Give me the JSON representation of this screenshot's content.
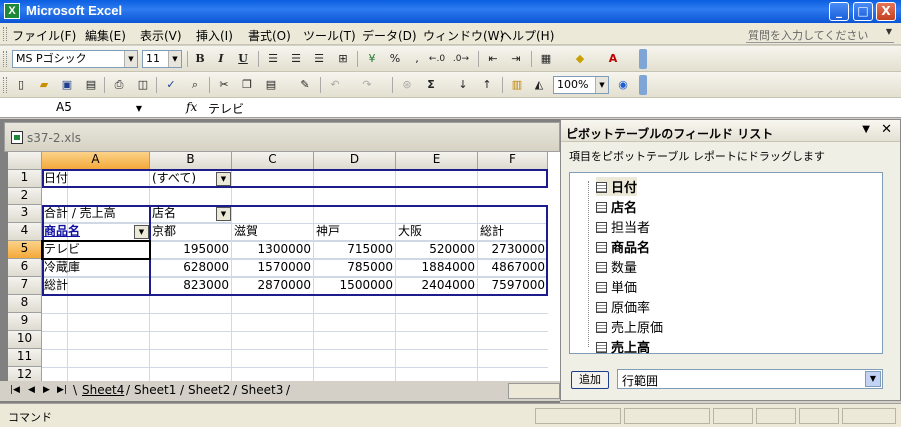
{
  "window": {
    "title": "Microsoft Excel",
    "min": "_",
    "max": "□",
    "close": "X"
  },
  "menu": {
    "items": [
      "ファイル(F)",
      "編集(E)",
      "表示(V)",
      "挿入(I)",
      "書式(O)",
      "ツール(T)",
      "データ(D)",
      "ウィンドウ(W)",
      "ヘルプ(H)"
    ],
    "help_placeholder": "質問を入力してください"
  },
  "toolbar_format": {
    "font": "MS Pゴシック",
    "size": "11",
    "bold": "B",
    "italic": "I",
    "underline": "U",
    "percent": "%",
    "comma": ","
  },
  "toolbar_standard": {
    "sigma": "Σ",
    "zoom": "100%"
  },
  "formula_bar": {
    "name_box": "A5",
    "fx": "fx",
    "value": "テレビ"
  },
  "workbook": {
    "title": "s37-2.xls",
    "columns": [
      "A",
      "B",
      "C",
      "D",
      "E",
      "F"
    ],
    "rows": [
      "1",
      "2",
      "3",
      "4",
      "5",
      "6",
      "7",
      "8",
      "9",
      "10",
      "11",
      "12"
    ],
    "cells": {
      "r1": {
        "a": "日付",
        "b": "(すべて)"
      },
      "r3": {
        "a": "合計 / 売上高",
        "b": "店名"
      },
      "r4": {
        "a": "商品名",
        "b": "京都",
        "c": "滋賀",
        "d": "神戸",
        "e": "大阪",
        "f": "総計"
      },
      "r5": {
        "a": "テレビ",
        "b": "195000",
        "c": "1300000",
        "d": "715000",
        "e": "520000",
        "f": "2730000"
      },
      "r6": {
        "a": "冷蔵庫",
        "b": "628000",
        "c": "1570000",
        "d": "785000",
        "e": "1884000",
        "f": "4867000"
      },
      "r7": {
        "a": "総計",
        "b": "823000",
        "c": "2870000",
        "d": "1500000",
        "e": "2404000",
        "f": "7597000"
      }
    },
    "sheets": [
      "Sheet4",
      "Sheet1",
      "Sheet2",
      "Sheet3"
    ],
    "active_sheet": "Sheet4"
  },
  "pivot_pane": {
    "title": "ピボットテーブルのフィールド リスト",
    "instruction": "項目をピボットテーブル レポートにドラッグします",
    "fields": [
      {
        "label": "日付",
        "used": true
      },
      {
        "label": "店名",
        "used": true
      },
      {
        "label": "担当者",
        "used": false
      },
      {
        "label": "商品名",
        "used": true
      },
      {
        "label": "数量",
        "used": false
      },
      {
        "label": "単価",
        "used": false
      },
      {
        "label": "原価率",
        "used": false
      },
      {
        "label": "売上原価",
        "used": false
      },
      {
        "label": "売上高",
        "used": true
      }
    ],
    "add_button": "追加",
    "area": "行範囲"
  },
  "status": {
    "text": "コマンド"
  }
}
